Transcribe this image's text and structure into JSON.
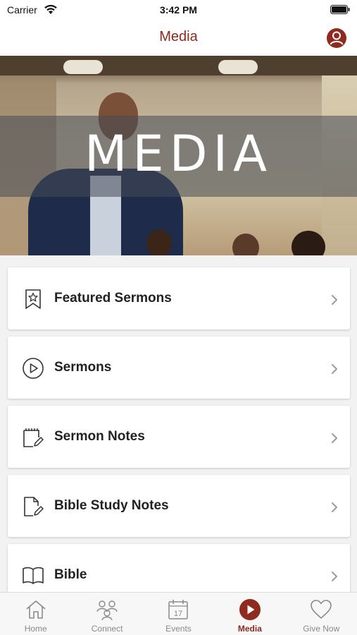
{
  "status_bar": {
    "carrier": "Carrier",
    "time": "3:42 PM",
    "wifi_icon": "wifi-icon",
    "battery_icon": "battery-icon"
  },
  "nav_bar": {
    "title": "Media",
    "profile_icon": "profile-icon"
  },
  "hero": {
    "title": "MEDIA"
  },
  "menu": {
    "items": [
      {
        "label": "Featured Sermons",
        "icon": "star-bookmark-icon"
      },
      {
        "label": "Sermons",
        "icon": "play-circle-icon"
      },
      {
        "label": "Sermon Notes",
        "icon": "notepad-pencil-icon"
      },
      {
        "label": "Bible Study Notes",
        "icon": "document-pencil-icon"
      },
      {
        "label": "Bible",
        "icon": "open-book-icon"
      }
    ]
  },
  "tab_bar": {
    "tabs": [
      {
        "label": "Home",
        "icon": "home-icon",
        "active": false
      },
      {
        "label": "Connect",
        "icon": "people-icon",
        "active": false
      },
      {
        "label": "Events",
        "icon": "calendar-icon",
        "active": false,
        "icon_text": "17"
      },
      {
        "label": "Media",
        "icon": "play-circle-filled-icon",
        "active": true
      },
      {
        "label": "Give Now",
        "icon": "heart-icon",
        "active": false
      }
    ]
  },
  "colors": {
    "accent": "#8f2a1f",
    "inactive": "#8a8a8a",
    "background": "#f2f2f2"
  }
}
